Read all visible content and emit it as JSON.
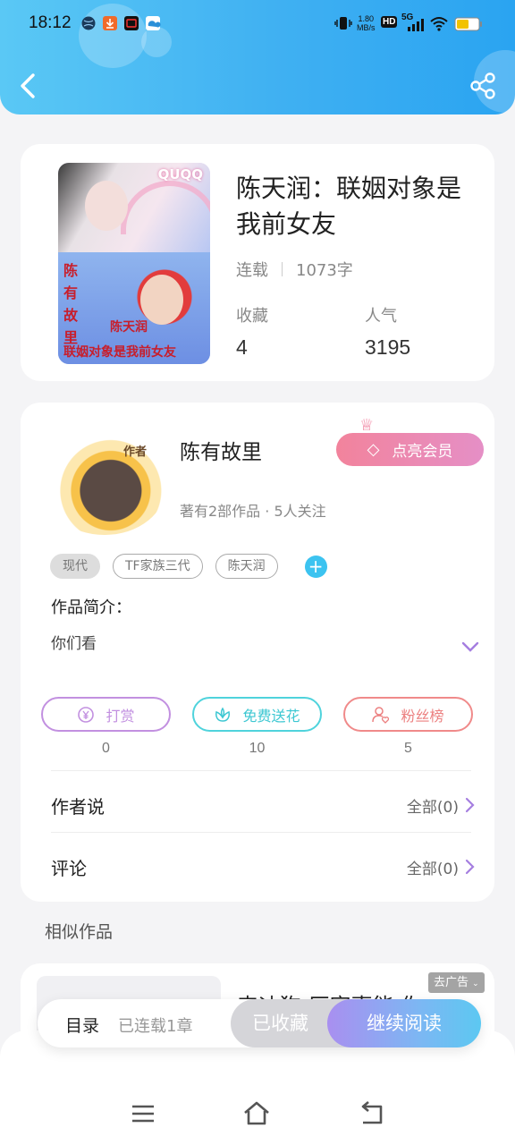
{
  "status_bar": {
    "time": "18:12",
    "network_speed": "1.80",
    "network_unit": "MB/s",
    "hd_label": "HD",
    "signal_label": "5G",
    "icons": [
      "globe-icon",
      "download-icon",
      "app-icon",
      "cloud-icon",
      "vibrate-icon",
      "wifi-icon",
      "battery-icon"
    ]
  },
  "header": {
    "back_icon": "back-arrow-icon",
    "share_icon": "share-icon"
  },
  "book": {
    "title": "陈天润：联姻对象是我前女友",
    "status": "连载",
    "word_count": "1073字",
    "favorites_label": "收藏",
    "favorites_value": "4",
    "popularity_label": "人气",
    "popularity_value": "3195",
    "cover_text": {
      "badge": "QUQQ",
      "vertical": "陈有故里",
      "name": "陈天润",
      "line": "联姻对象是我前女友"
    }
  },
  "author": {
    "avatar_tag": "作者",
    "name": "陈有故里",
    "vip_label": "点亮会员",
    "meta": "著有2部作品 · 5人关注",
    "tags": [
      "现代",
      "TF家族三代",
      "陈天润"
    ],
    "intro_label": "作品简介：",
    "intro_text": "你们看"
  },
  "actions": [
    {
      "label": "打赏",
      "count": "0",
      "color": "#c290e0",
      "icon": "yuan-coin-icon"
    },
    {
      "label": "免费送花",
      "count": "10",
      "color": "#4fd3dc",
      "icon": "flower-icon"
    },
    {
      "label": "粉丝榜",
      "count": "5",
      "color": "#f08a8a",
      "icon": "fan-user-icon"
    }
  ],
  "author_says": {
    "title": "作者说",
    "summary": "全部(0)"
  },
  "comments": {
    "title": "评论",
    "summary": "全部(0)"
  },
  "similar": {
    "title": "相似作品",
    "first_item_text": "森迪狗 厉害事能 你",
    "ad_label": "去广告"
  },
  "bottom_bar": {
    "catalog": "目录",
    "chapters": "已连载1章",
    "favorited": "已收藏",
    "continue_read": "继续阅读"
  },
  "colors": {
    "header_gradient_start": "#5ac8f5",
    "header_gradient_end": "#2aa4f1",
    "vip_gradient_start": "#f2839c",
    "read_button_start": "#a98ff0",
    "read_button_end": "#5cc8f2",
    "accent_purple": "#a57ee0"
  }
}
